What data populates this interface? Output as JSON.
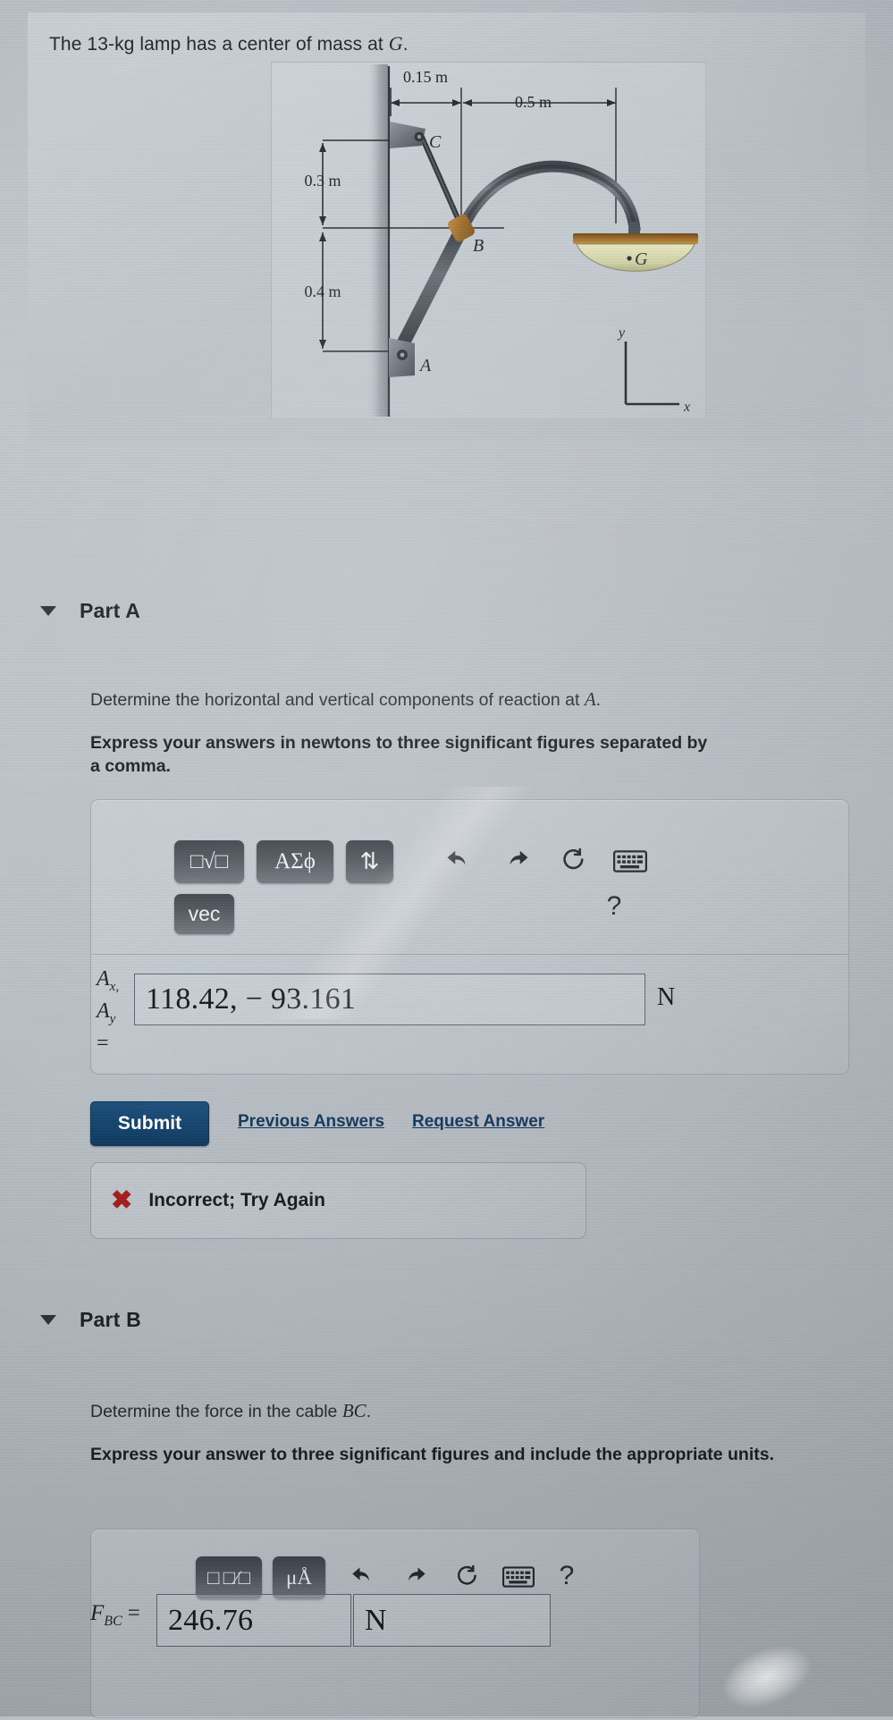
{
  "problem": {
    "statement_prefix": "The 13-kg lamp has a center of mass at ",
    "statement_symbol": "G",
    "statement_suffix": "."
  },
  "figure": {
    "labels": {
      "dim_top": "0.15 m",
      "dim_right": "0.5 m",
      "dim_upper_left": "0.3 m",
      "dim_lower_left": "0.4 m",
      "point_c": "C",
      "point_b": "B",
      "point_a": "A",
      "point_g": "G",
      "axis_y": "y",
      "axis_x": "x"
    },
    "colors": {
      "background": "#c4cbd1",
      "arm": "#5a6068",
      "joint": "#a8762f",
      "shade_top": "#8a5a22",
      "shade_bottom": "#d8d8ae"
    }
  },
  "parts": [
    {
      "id": "part-a",
      "title": "Part A",
      "question": "Determine the horizontal and vertical components of reaction at ",
      "question_symbol": "A",
      "question_suffix": ".",
      "instruction": "Express your answers in newtons to three significant figures separated by a comma.",
      "toolbar": {
        "buttons": [
          {
            "name": "template-sqrt-button",
            "label": "□√□"
          },
          {
            "name": "greek-symbols-button",
            "label": "ΑΣϕ"
          },
          {
            "name": "updown-arrows-button",
            "label": "⇅"
          },
          {
            "name": "vec-button",
            "label": "vec"
          }
        ],
        "icons": [
          {
            "name": "undo-icon",
            "label": "undo"
          },
          {
            "name": "redo-icon",
            "label": "redo"
          },
          {
            "name": "reset-icon",
            "label": "reset"
          },
          {
            "name": "keyboard-icon",
            "label": "keyboard"
          },
          {
            "name": "help-icon",
            "label": "?"
          }
        ]
      },
      "answer": {
        "label_line1": "A",
        "label_sub1": "x,",
        "label_line2": "A",
        "label_sub2": "y",
        "label_equals": "=",
        "value": "118.42, − 93.161",
        "placeholder": "",
        "units": "N"
      },
      "actions": {
        "submit": "Submit",
        "previous_answers": "Previous Answers",
        "request_answer": "Request Answer"
      },
      "feedback": {
        "icon": "x-mark-icon",
        "text": "Incorrect; Try Again",
        "color": "#a61c1c"
      }
    },
    {
      "id": "part-b",
      "title": "Part B",
      "question": "Determine the force in the cable ",
      "question_symbol": "BC",
      "question_suffix": ".",
      "instruction": "Express your answer to three significant figures and include the appropriate units.",
      "toolbar": {
        "buttons": [
          {
            "name": "template-fraction-button",
            "label": "□ □∕□"
          },
          {
            "name": "units-button",
            "label": "μÅ"
          }
        ],
        "icons": [
          {
            "name": "undo-icon",
            "label": "undo"
          },
          {
            "name": "redo-icon",
            "label": "redo"
          },
          {
            "name": "reset-icon",
            "label": "reset"
          },
          {
            "name": "keyboard-icon",
            "label": "keyboard"
          },
          {
            "name": "help-icon",
            "label": "?"
          }
        ]
      },
      "answer": {
        "label": "F",
        "label_sub": "BC",
        "label_equals": "=",
        "value": "246.76",
        "placeholder": "",
        "units_value": "N"
      }
    }
  ],
  "theme": {
    "page_background": "#b9bfc4",
    "submit_blue": "#14456f",
    "link_blue": "#12355c",
    "text_dark": "#1a2026"
  }
}
